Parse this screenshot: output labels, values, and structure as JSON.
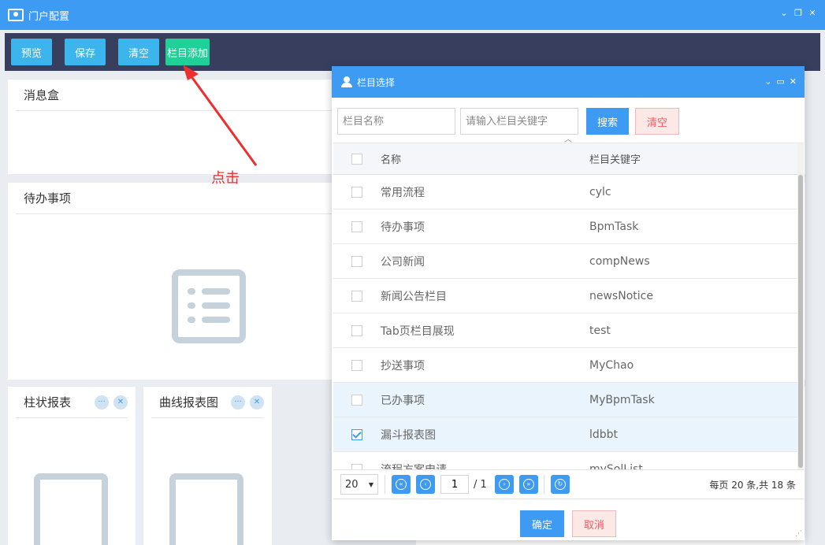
{
  "window": {
    "title": "门户配置",
    "controls": [
      "collapse-icon",
      "restore-icon",
      "close-icon"
    ]
  },
  "toolbar": {
    "preview_label": "预览",
    "save_label": "保存",
    "clear_label": "清空",
    "add_column_label": "栏目添加"
  },
  "panels": {
    "message_box": "消息盒",
    "todo": "待办事项",
    "bar_report": "柱状报表",
    "curve_report": "曲线报表图"
  },
  "annotation": {
    "text": "点击",
    "color": "#f02d2d"
  },
  "dialog": {
    "title": "栏目选择",
    "search": {
      "name_placeholder": "栏目名称",
      "key_placeholder": "请输入栏目关键字",
      "search_label": "搜索",
      "clear_label": "清空"
    },
    "columns": {
      "name": "名称",
      "key": "栏目关键字"
    },
    "rows": [
      {
        "name": "常用流程",
        "key": "cylc",
        "checked": false
      },
      {
        "name": "待办事项",
        "key": "BpmTask",
        "checked": false
      },
      {
        "name": "公司新闻",
        "key": "compNews",
        "checked": false
      },
      {
        "name": "新闻公告栏目",
        "key": "newsNotice",
        "checked": false
      },
      {
        "name": "Tab页栏目展现",
        "key": "test",
        "checked": false
      },
      {
        "name": "抄送事项",
        "key": "MyChao",
        "checked": false
      },
      {
        "name": "已办事项",
        "key": "MyBpmTask",
        "checked": false
      },
      {
        "name": "漏斗报表图",
        "key": "ldbbt",
        "checked": true
      },
      {
        "name": "流程方案申请",
        "key": "mySolList",
        "checked": false
      }
    ],
    "pager": {
      "page_size": "20",
      "current_page": "1",
      "total_pages": "/ 1",
      "info": "每页 20 条,共 18 条"
    },
    "footer": {
      "ok_label": "确定",
      "cancel_label": "取消"
    }
  },
  "colors": {
    "primary": "#3e9bf3",
    "toolbar_bg": "#383f5e",
    "accent_green": "#1fd098",
    "danger": "#f25a5a"
  }
}
